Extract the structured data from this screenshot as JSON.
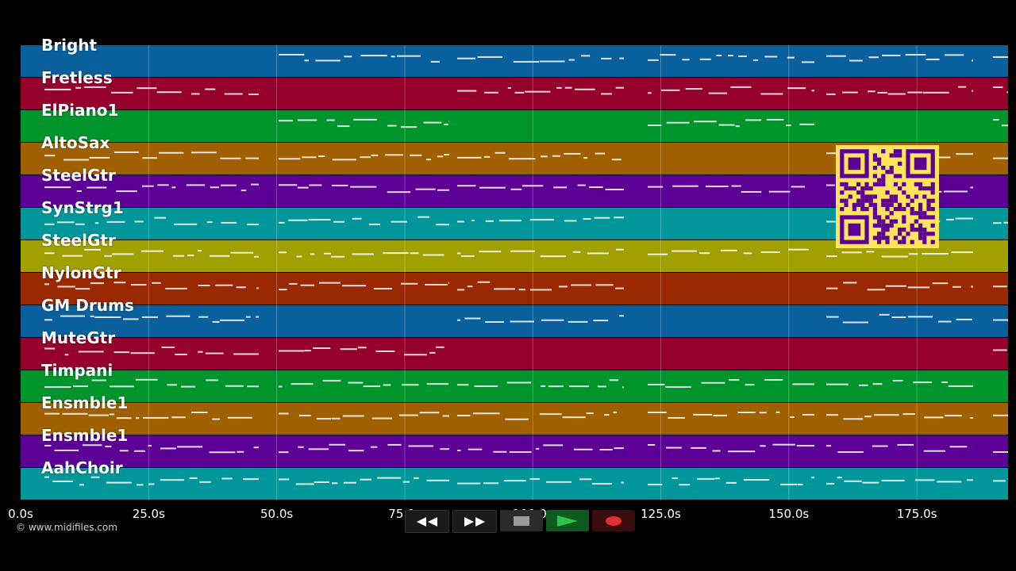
{
  "tracks": [
    {
      "label": "Bright",
      "color": "#0a609c"
    },
    {
      "label": "Fretless",
      "color": "#96002c"
    },
    {
      "label": "ElPiano1",
      "color": "#00952c"
    },
    {
      "label": "AltoSax",
      "color": "#a06000"
    },
    {
      "label": "SteelGtr",
      "color": "#5c0096"
    },
    {
      "label": "SynStrg1",
      "color": "#00969a"
    },
    {
      "label": "SteelGtr",
      "color": "#a0a000"
    },
    {
      "label": "NylonGtr",
      "color": "#9a2800"
    },
    {
      "label": "GM Drums",
      "color": "#0a609c"
    },
    {
      "label": "MuteGtr",
      "color": "#96002c"
    },
    {
      "label": "Timpani",
      "color": "#00952c"
    },
    {
      "label": "Ensmble1",
      "color": "#a06000"
    },
    {
      "label": "Ensmble1",
      "color": "#5c0096"
    },
    {
      "label": "AahChoir",
      "color": "#00969a"
    }
  ],
  "time_axis": {
    "ticks": [
      "0.0s",
      "25.0s",
      "50.0s",
      "75.0s",
      "100.0s",
      "125.0s",
      "150.0s",
      "175.0s"
    ]
  },
  "copyright": "© www.midifiles.com",
  "transport": {
    "rewind_icon": "rewind-icon",
    "fastforward_icon": "fast-forward-icon",
    "stop_icon": "stop-icon",
    "play_icon": "play-icon",
    "record_icon": "record-icon"
  },
  "colors": {
    "background": "#000000",
    "qr_yellow": "#ffe45c",
    "qr_purple": "#5c0096"
  }
}
